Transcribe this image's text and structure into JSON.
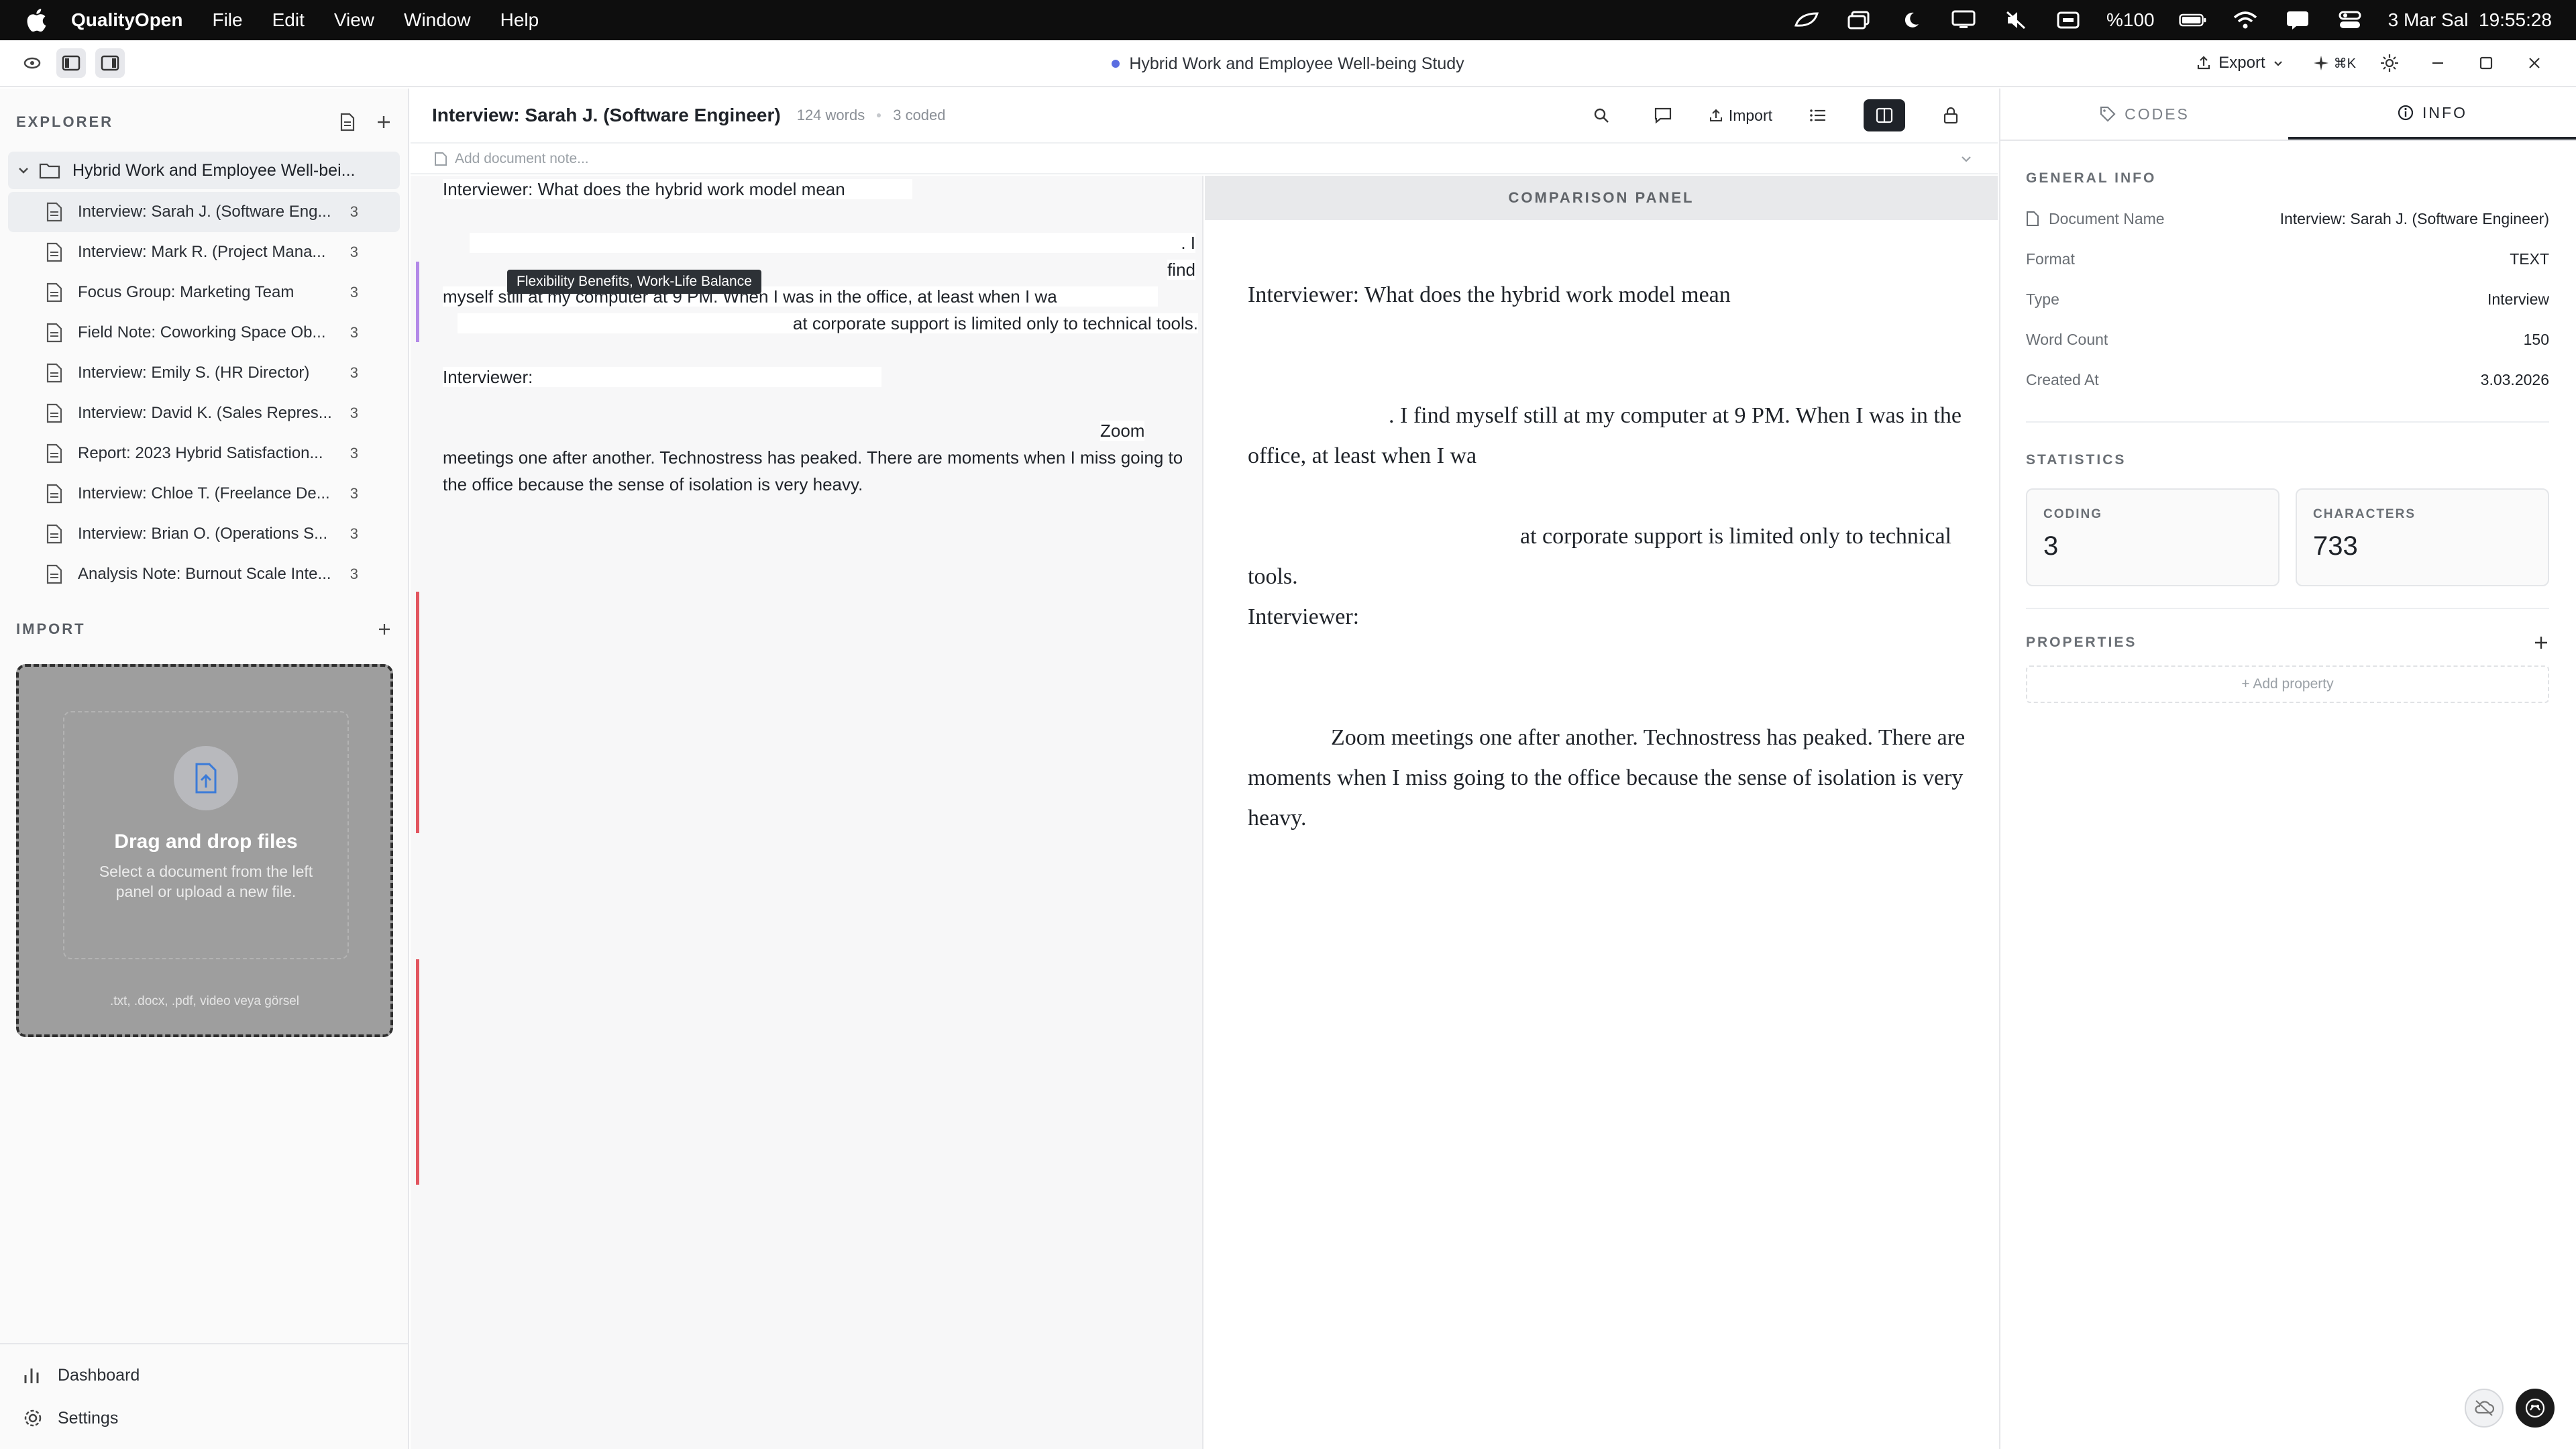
{
  "menubar": {
    "app_name": "QualityOpen",
    "items": [
      "File",
      "Edit",
      "View",
      "Window",
      "Help"
    ],
    "battery": "%100",
    "datetime": "3 Mar Sal  19:55:28"
  },
  "titlebar": {
    "document_title": "Hybrid Work and Employee Well-being Study",
    "export_label": "Export",
    "shortcut_label": "⌘K"
  },
  "sidebar": {
    "explorer_label": "EXPLORER",
    "project_name": "Hybrid Work and Employee Well-bei...",
    "files": [
      {
        "name": "Interview: Sarah J. (Software Eng...",
        "count": "3"
      },
      {
        "name": "Interview: Mark R. (Project Mana...",
        "count": "3"
      },
      {
        "name": "Focus Group: Marketing Team",
        "count": "3"
      },
      {
        "name": "Field Note: Coworking Space Ob...",
        "count": "3"
      },
      {
        "name": "Interview: Emily S. (HR Director)",
        "count": "3"
      },
      {
        "name": "Interview: David K. (Sales Repres...",
        "count": "3"
      },
      {
        "name": "Report: 2023 Hybrid Satisfaction...",
        "count": "3"
      },
      {
        "name": "Interview: Chloe T. (Freelance De...",
        "count": "3"
      },
      {
        "name": "Interview: Brian O. (Operations S...",
        "count": "3"
      },
      {
        "name": "Analysis Note: Burnout Scale Inte...",
        "count": "3"
      }
    ],
    "import_label": "IMPORT",
    "dropzone": {
      "title": "Drag and drop files",
      "subtitle": "Select a document from the left panel or upload a new file.",
      "types": ".txt, .docx, .pdf, video veya görsel"
    },
    "footer": {
      "dashboard": "Dashboard",
      "settings": "Settings"
    }
  },
  "document": {
    "title": "Interview: Sarah J. (Software Engineer)",
    "word_count": "124 words",
    "coded_count": "3 coded",
    "import_label": "Import",
    "note_placeholder": "Add document note...",
    "tooltip": "Flexibility Benefits, Work-Life Balance",
    "editor": {
      "line1": "Interviewer: What does the hybrid work model mean",
      "line2a": ". I find",
      "line2b": "myself still at my computer at 9 PM. When I was in the office, at least when I wa",
      "line3": "at corporate support is limited only to technical tools.",
      "line4": "Interviewer:",
      "line5a": "Zoom",
      "line5b": "meetings one after another. Technostress has peaked. There are moments when I miss going to the office because the sense of isolation is very heavy."
    },
    "bars": {
      "purple": "#b389e8",
      "red": "#e2555f"
    }
  },
  "comparison": {
    "header": "COMPARISON PANEL",
    "p1": "Interviewer: What does the hybrid work model mean",
    "p2": ". I find myself still at my computer at 9 PM. When I was in the office, at least when I wa",
    "p3": "at corporate support is limited only to technical tools.",
    "p4": "Interviewer:",
    "p5": "Zoom meetings one after another. Technostress has peaked. There are moments when I miss going to the office because the sense of isolation is very heavy."
  },
  "inspector": {
    "tab_codes": "CODES",
    "tab_info": "INFO",
    "general_info_label": "GENERAL INFO",
    "rows": [
      {
        "key": "Document Name",
        "value": "Interview: Sarah J. (Software Engineer)"
      },
      {
        "key": "Format",
        "value": "TEXT"
      },
      {
        "key": "Type",
        "value": "Interview"
      },
      {
        "key": "Word Count",
        "value": "150"
      },
      {
        "key": "Created At",
        "value": "3.03.2026"
      }
    ],
    "statistics_label": "STATISTICS",
    "coding_label": "CODING",
    "coding_value": "3",
    "characters_label": "CHARACTERS",
    "characters_value": "733",
    "properties_label": "PROPERTIES",
    "add_property": "+ Add property"
  }
}
